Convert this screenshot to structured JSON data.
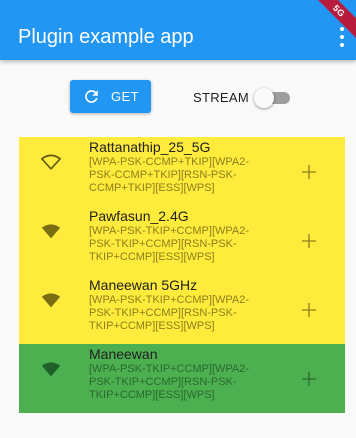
{
  "appbar": {
    "title": "Plugin example app",
    "menu_icon": "more-vert-icon",
    "color": "#2196f3",
    "debug_banner": "5G"
  },
  "controls": {
    "get_button_label": "GET",
    "get_button_icon": "refresh-icon",
    "stream_label": "STREAM",
    "stream_enabled": false
  },
  "networks": [
    {
      "ssid": "Rattanathip_25_5G",
      "capabilities": "[WPA-PSK-CCMP+TKIP][WPA2-\nPSK-CCMP+TKIP][RSN-PSK-\nCCMP+TKIP][ESS][WPS]",
      "signal_icon": "wifi-outline-icon",
      "background": "#ffeb3b",
      "caps_color": "#8d7f1c",
      "icon_color": "#5f5a14"
    },
    {
      "ssid": "Pawfasun_2.4G",
      "capabilities": "[WPA-PSK-TKIP+CCMP][WPA2-\nPSK-TKIP+CCMP][RSN-PSK-\nTKIP+CCMP][ESS][WPS]",
      "signal_icon": "wifi-filled-icon",
      "background": "#ffeb3b",
      "caps_color": "#8d7f1c",
      "icon_color": "#7a6e12"
    },
    {
      "ssid": "Maneewan 5GHz",
      "capabilities": "[WPA-PSK-TKIP+CCMP][WPA2-\nPSK-TKIP+CCMP][RSN-PSK-\nTKIP+CCMP][ESS][WPS]",
      "signal_icon": "wifi-filled-icon",
      "background": "#ffeb3b",
      "caps_color": "#8d7f1c",
      "icon_color": "#7a6e12"
    },
    {
      "ssid": "Maneewan",
      "capabilities": "[WPA-PSK-TKIP+CCMP][WPA2-\nPSK-TKIP+CCMP][RSN-PSK-\nTKIP+CCMP][ESS][WPS]",
      "signal_icon": "wifi-filled-icon",
      "background": "#4caf50",
      "caps_color": "#2b6a2e",
      "icon_color": "#1f5f28"
    }
  ]
}
